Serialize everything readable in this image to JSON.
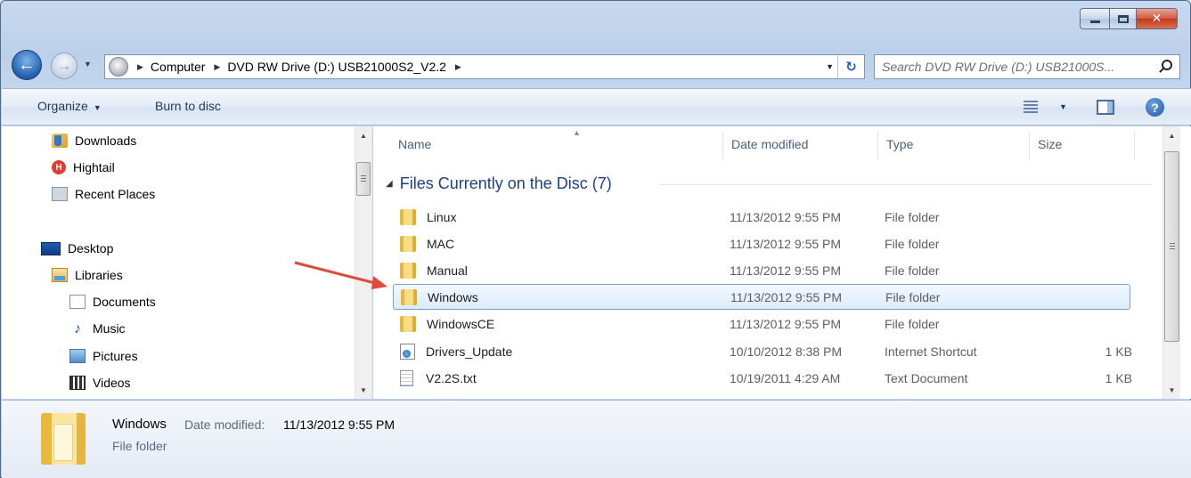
{
  "window": {
    "caption_buttons": {
      "minimize": "minimize",
      "maximize": "maximize",
      "close": "✕"
    }
  },
  "nav": {
    "back_glyph": "←",
    "forward_glyph": "→",
    "breadcrumb": [
      "Computer",
      "DVD RW Drive (D:) USB21000S2_V2.2"
    ],
    "refresh_glyph": "↻"
  },
  "search": {
    "placeholder": "Search DVD RW Drive (D:) USB21000S..."
  },
  "toolbar": {
    "organize": "Organize",
    "burn": "Burn to disc",
    "help": "?"
  },
  "sidebar": {
    "items": [
      {
        "label": "Downloads",
        "icon": "downloads-folder-icon"
      },
      {
        "label": "Hightail",
        "icon": "hightail-icon"
      },
      {
        "label": "Recent Places",
        "icon": "recent-places-icon"
      },
      {
        "label": "Desktop",
        "icon": "desktop-icon"
      },
      {
        "label": "Libraries",
        "icon": "libraries-icon"
      },
      {
        "label": "Documents",
        "icon": "documents-icon"
      },
      {
        "label": "Music",
        "icon": "music-icon"
      },
      {
        "label": "Pictures",
        "icon": "pictures-icon"
      },
      {
        "label": "Videos",
        "icon": "videos-icon"
      }
    ]
  },
  "columns": {
    "name": "Name",
    "date": "Date modified",
    "type": "Type",
    "size": "Size"
  },
  "group": {
    "title": "Files Currently on the Disc (7)"
  },
  "files": [
    {
      "name": "Linux",
      "date": "11/13/2012 9:55 PM",
      "type": "File folder",
      "size": "",
      "icon": "folder-icon"
    },
    {
      "name": "MAC",
      "date": "11/13/2012 9:55 PM",
      "type": "File folder",
      "size": "",
      "icon": "folder-icon"
    },
    {
      "name": "Manual",
      "date": "11/13/2012 9:55 PM",
      "type": "File folder",
      "size": "",
      "icon": "folder-icon"
    },
    {
      "name": "Windows",
      "date": "11/13/2012 9:55 PM",
      "type": "File folder",
      "size": "",
      "icon": "folder-icon",
      "selected": true
    },
    {
      "name": "WindowsCE",
      "date": "11/13/2012 9:55 PM",
      "type": "File folder",
      "size": "",
      "icon": "folder-icon"
    },
    {
      "name": "Drivers_Update",
      "date": "10/10/2012 8:38 PM",
      "type": "Internet Shortcut",
      "size": "1 KB",
      "icon": "internet-shortcut-icon"
    },
    {
      "name": "V2.2S.txt",
      "date": "10/19/2011 4:29 AM",
      "type": "Text Document",
      "size": "1 KB",
      "icon": "text-document-icon"
    }
  ],
  "details": {
    "name": "Windows",
    "date_label": "Date modified:",
    "date_value": "11/13/2012 9:55 PM",
    "type": "File folder"
  },
  "colors": {
    "accent": "#1e3f8a",
    "annotation_arrow": "#e04a3a",
    "selection_border": "#7da2ce"
  }
}
